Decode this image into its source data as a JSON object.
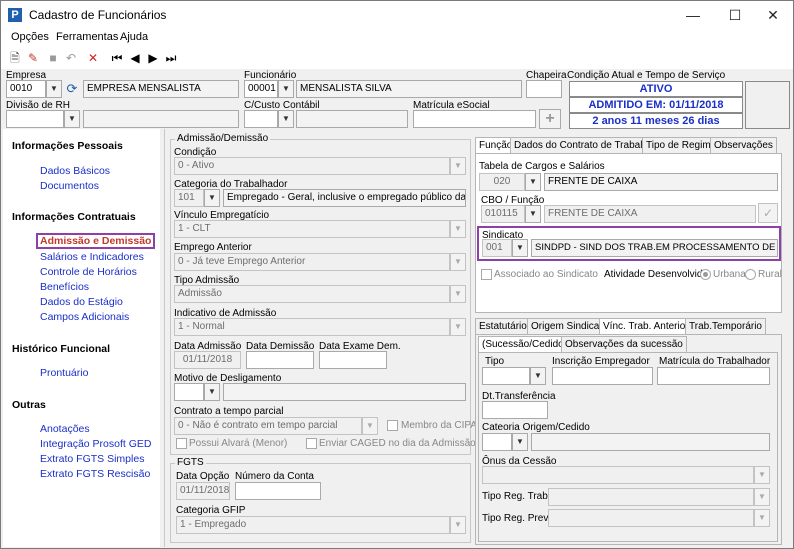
{
  "window": {
    "title": "Cadastro de Funcionários"
  },
  "menu": [
    "Opções",
    "Ferramentas",
    "Ajuda"
  ],
  "header": {
    "empresa_label": "Empresa",
    "empresa_code": "0010",
    "empresa_name": "EMPRESA MENSALISTA",
    "funcionario_label": "Funcionário",
    "funcionario_code": "00001",
    "funcionario_name": "MENSALISTA SILVA",
    "chapeira_label": "Chapeira",
    "condicao_label": "Condição Atual e Tempo de Serviço",
    "status_ativo": "ATIVO",
    "status_admitido": "ADMITIDO EM: 01/11/2018",
    "status_tempo": "2 anos 11 meses 26 dias",
    "divisao_label": "Divisão de RH",
    "ccusto_label": "C/Custo Contábil",
    "matricula_label": "Matrícula eSocial"
  },
  "sidebar": {
    "sections": [
      {
        "title": "Informações Pessoais",
        "items": [
          "Dados Básicos",
          "Documentos"
        ]
      },
      {
        "title": "Informações Contratuais",
        "items": [
          "Admissão e Demissão",
          "Salários e Indicadores",
          "Controle de Horários",
          "Benefícios",
          "Dados do Estágio",
          "Campos Adicionais"
        ]
      },
      {
        "title": "Histórico Funcional",
        "items": [
          "Prontuário"
        ]
      },
      {
        "title": "Outras",
        "items": [
          "Anotações",
          "Integração Prosoft GED",
          "Extrato FGTS Simples",
          "Extrato FGTS Rescisão"
        ]
      }
    ],
    "active": "Admissão e Demissão"
  },
  "admissao": {
    "group_label": "Admissão/Demissão",
    "condicao_label": "Condição",
    "condicao_value": "0 - Ativo",
    "categoria_label": "Categoria do Trabalhador",
    "categoria_code": "101",
    "categoria_value": "Empregado - Geral, inclusive o empregado público da administ",
    "vinculo_label": "Vínculo Empregatício",
    "vinculo_value": "1 - CLT",
    "emprego_label": "Emprego Anterior",
    "emprego_value": "0 - Já teve Emprego Anterior",
    "tipo_label": "Tipo Admissão",
    "tipo_value": "Admissão",
    "indicativo_label": "Indicativo de Admissão",
    "indicativo_value": "1 - Normal",
    "data_adm_label": "Data Admissão",
    "data_adm_value": "01/11/2018",
    "data_dem_label": "Data Demissão",
    "data_exame_label": "Data Exame Dem.",
    "motivo_label": "Motivo de Desligamento",
    "contrato_label": "Contrato a tempo parcial",
    "contrato_value": "0 - Não é contrato em tempo parcial",
    "cipa_label": "Membro da CIPA",
    "alvara_label": "Possui Alvará (Menor)",
    "caged_label": "Enviar CAGED no dia da Admissão?"
  },
  "fgts": {
    "group_label": "FGTS",
    "data_opcao_label": "Data Opção",
    "data_opcao_value": "01/11/2018",
    "conta_label": "Número da Conta",
    "gfip_label": "Categoria GFIP",
    "gfip_value": "1 - Empregado"
  },
  "right_tabs": [
    "Função",
    "Dados do Contrato de Trabalho",
    "Tipo de Regime",
    "Observações"
  ],
  "funcao": {
    "tabela_label": "Tabela de Cargos e Salários",
    "tabela_code": "020",
    "tabela_value": "FRENTE DE CAIXA",
    "cbo_label": "CBO / Função",
    "cbo_code": "010115",
    "cbo_value": "FRENTE DE CAIXA",
    "sindicato_label": "Sindicato",
    "sindicato_code": "001",
    "sindicato_value": "SINDPD - SIND DOS TRAB.EM PROCESSAMENTO DE DADOS ES",
    "associado_label": "Associado ao Sindicato",
    "atividade_label": "Atividade Desenvolvida:",
    "urbana_label": "Urbana",
    "rural_label": "Rural"
  },
  "bottom_tabs": [
    "Estatutário",
    "Origem Sindical",
    "Vínc. Trab. Anterior",
    "Trab.Temporário",
    "(Sucessão/Cedido)",
    "Observações da sucessão"
  ],
  "vinculo": {
    "tipo_label": "Tipo",
    "inscricao_label": "Inscrição Empregador",
    "matricula_label": "Matrícula do Trabalhador",
    "dt_transf_label": "Dt.Transferência",
    "categoria_label": "Cateoria Origem/Cedido",
    "onus_label": "Ônus da Cessão",
    "tipo_reg_trab_label": "Tipo Reg. Trab.",
    "tipo_reg_prev_label": "Tipo Reg. Prev."
  }
}
